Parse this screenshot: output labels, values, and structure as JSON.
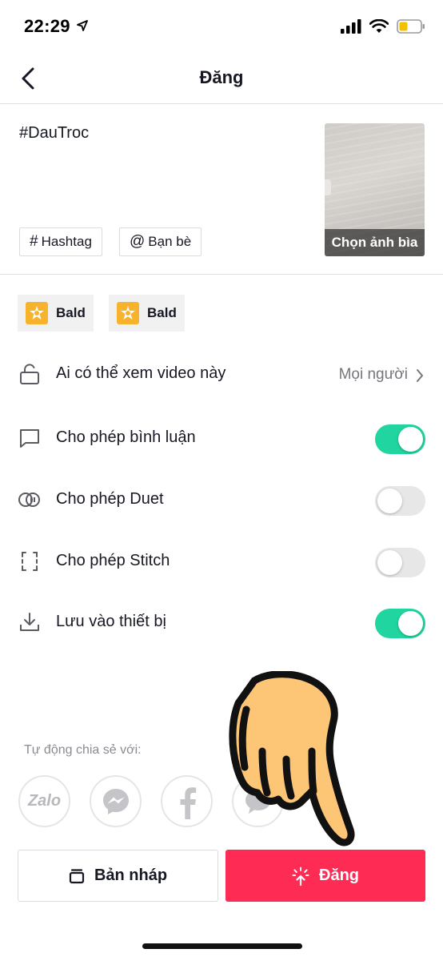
{
  "status_bar": {
    "time": "22:29"
  },
  "nav": {
    "title": "Đăng"
  },
  "post": {
    "caption": "#DauTroc",
    "hashtag_label": "Hashtag",
    "friends_label": "Bạn bè",
    "cover_label": "Chọn ảnh bìa"
  },
  "effects": [
    {
      "label": "Bald"
    },
    {
      "label": "Bald"
    }
  ],
  "settings": {
    "privacy": {
      "label": "Ai có thể xem video này",
      "value": "Mọi người"
    },
    "comments": {
      "label": "Cho phép bình luận",
      "enabled": true
    },
    "duet": {
      "label": "Cho phép Duet",
      "enabled": false
    },
    "stitch": {
      "label": "Cho phép Stitch",
      "enabled": false
    },
    "save": {
      "label": "Lưu vào thiết bị",
      "enabled": true
    }
  },
  "share": {
    "label": "Tự động chia sẻ với:",
    "zalo_text": "Zalo",
    "targets": [
      "zalo-icon",
      "messenger-icon",
      "facebook-icon",
      "message-icon"
    ]
  },
  "actions": {
    "draft_label": "Bản nháp",
    "post_label": "Đăng"
  },
  "colors": {
    "accent": "#fe2c55",
    "toggle_on": "#20d5a0",
    "effect": "#f7b32b"
  }
}
